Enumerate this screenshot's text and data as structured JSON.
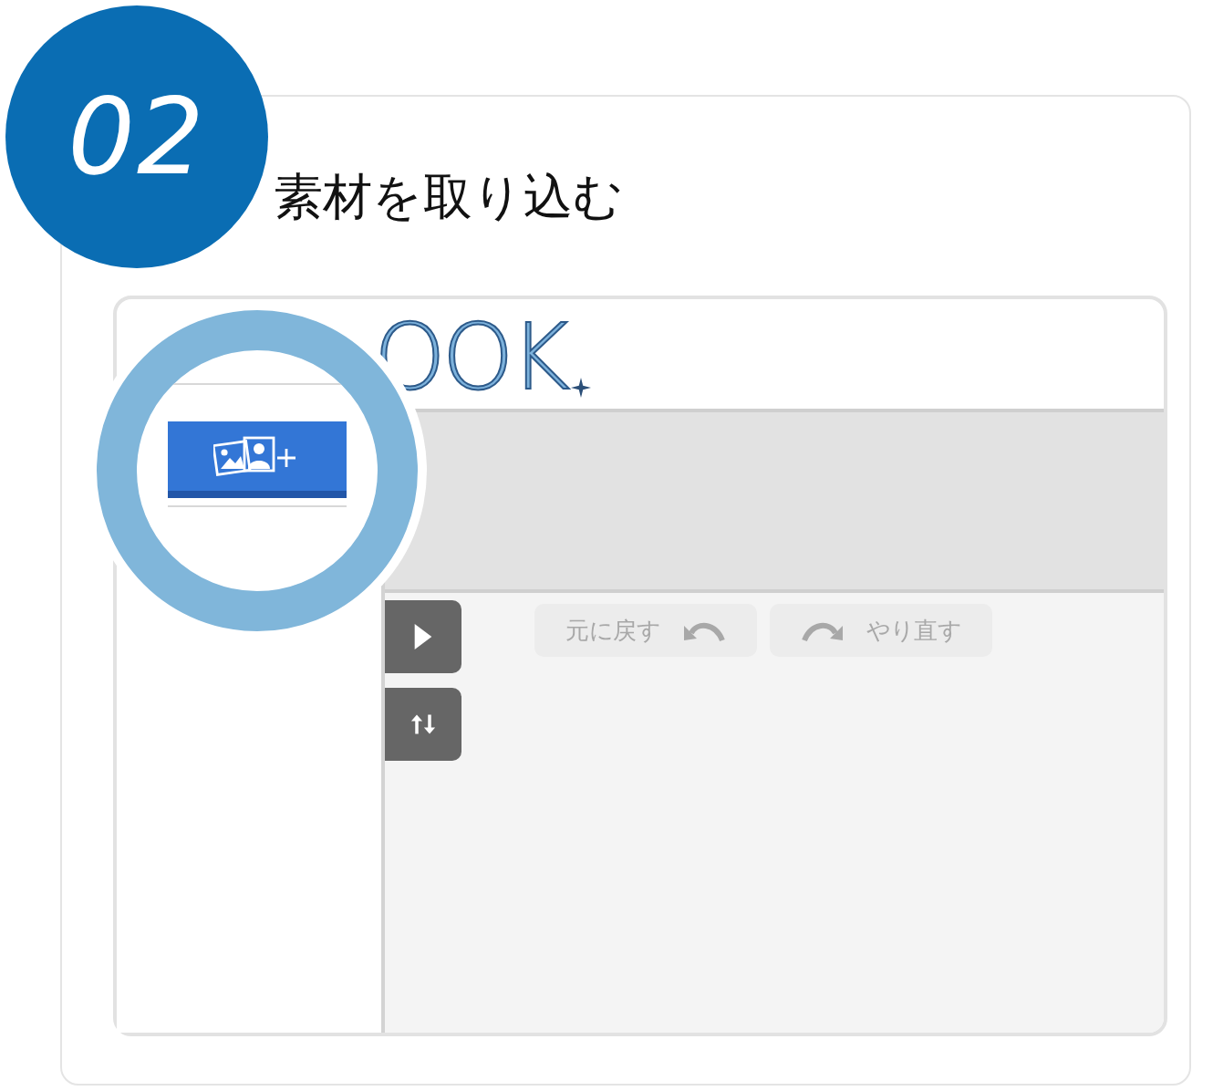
{
  "step": {
    "number": "02",
    "title": "素材を取り込む"
  },
  "app": {
    "logo": "OOK",
    "zoom_button": {
      "kind": "add-image"
    },
    "side_tools": [
      {
        "kind": "play"
      },
      {
        "kind": "swap"
      }
    ],
    "history": [
      {
        "kind": "undo",
        "label": "元に戻す",
        "disabled": true
      },
      {
        "kind": "redo",
        "label": "やり直す",
        "disabled": true
      }
    ]
  }
}
